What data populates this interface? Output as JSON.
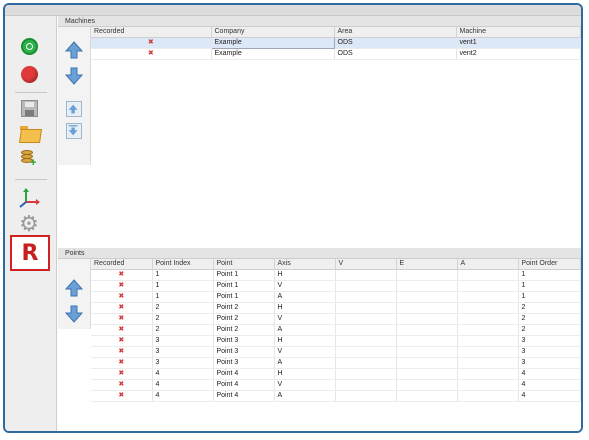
{
  "toolbar": {
    "icons": [
      "record-icon",
      "stop-icon",
      "save-icon",
      "open-folder-icon",
      "add-database-icon",
      "axis-icon",
      "gear-icon"
    ],
    "r_button_label": "R",
    "accent_color": "#2e6aa0",
    "highlight_color": "#d02020"
  },
  "machines": {
    "title": "Machines",
    "columns": [
      "Recorded",
      "Company",
      "Area",
      "Machine"
    ],
    "rows": [
      {
        "recorded": "✖",
        "company": "Example",
        "area": "ODS",
        "machine": "vent1",
        "selected": true
      },
      {
        "recorded": "✖",
        "company": "Example",
        "area": "ODS",
        "machine": "vent2",
        "selected": false
      }
    ]
  },
  "points": {
    "title": "Points",
    "columns": [
      "Recorded",
      "Point Index",
      "Point",
      "Axis",
      "V",
      "E",
      "A",
      "Point Order"
    ],
    "rows": [
      {
        "recorded": "✖",
        "index": "1",
        "point": "Point 1",
        "axis": "H",
        "v": "",
        "e": "",
        "a": "",
        "order": "1"
      },
      {
        "recorded": "✖",
        "index": "1",
        "point": "Point 1",
        "axis": "V",
        "v": "",
        "e": "",
        "a": "",
        "order": "1"
      },
      {
        "recorded": "✖",
        "index": "1",
        "point": "Point 1",
        "axis": "A",
        "v": "",
        "e": "",
        "a": "",
        "order": "1"
      },
      {
        "recorded": "✖",
        "index": "2",
        "point": "Point 2",
        "axis": "H",
        "v": "",
        "e": "",
        "a": "",
        "order": "2"
      },
      {
        "recorded": "✖",
        "index": "2",
        "point": "Point 2",
        "axis": "V",
        "v": "",
        "e": "",
        "a": "",
        "order": "2"
      },
      {
        "recorded": "✖",
        "index": "2",
        "point": "Point 2",
        "axis": "A",
        "v": "",
        "e": "",
        "a": "",
        "order": "2"
      },
      {
        "recorded": "✖",
        "index": "3",
        "point": "Point 3",
        "axis": "H",
        "v": "",
        "e": "",
        "a": "",
        "order": "3"
      },
      {
        "recorded": "✖",
        "index": "3",
        "point": "Point 3",
        "axis": "V",
        "v": "",
        "e": "",
        "a": "",
        "order": "3"
      },
      {
        "recorded": "✖",
        "index": "3",
        "point": "Point 3",
        "axis": "A",
        "v": "",
        "e": "",
        "a": "",
        "order": "3"
      },
      {
        "recorded": "✖",
        "index": "4",
        "point": "Point 4",
        "axis": "H",
        "v": "",
        "e": "",
        "a": "",
        "order": "4"
      },
      {
        "recorded": "✖",
        "index": "4",
        "point": "Point 4",
        "axis": "V",
        "v": "",
        "e": "",
        "a": "",
        "order": "4"
      },
      {
        "recorded": "✖",
        "index": "4",
        "point": "Point 4",
        "axis": "A",
        "v": "",
        "e": "",
        "a": "",
        "order": "4"
      }
    ]
  }
}
